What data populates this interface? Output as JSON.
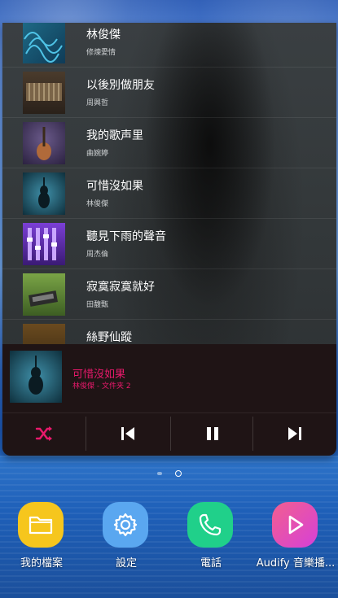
{
  "playlist": [
    {
      "title": "林俊傑",
      "artist": "修煉愛情"
    },
    {
      "title": "以後別做朋友",
      "artist": "周興哲"
    },
    {
      "title": "我的歌声里",
      "artist": "曲婉婷"
    },
    {
      "title": "可惜沒如果",
      "artist": "林俊傑"
    },
    {
      "title": "聽見下雨的聲音",
      "artist": "周杰倫"
    },
    {
      "title": "寂寞寂寞就好",
      "artist": "田馥甄"
    },
    {
      "title": "絲野仙蹤",
      "artist": ""
    }
  ],
  "now_playing": {
    "title": "可惜沒如果",
    "subtitle": "林俊傑 - 文件夹 2"
  },
  "controls": [
    "shuffle-icon",
    "previous-icon",
    "pause-icon",
    "next-icon"
  ],
  "dock": [
    {
      "label": "我的檔案",
      "icon": "folder-icon",
      "color": "#f6c61d"
    },
    {
      "label": "設定",
      "icon": "gear-icon",
      "color": "#5aa7f0"
    },
    {
      "label": "電話",
      "icon": "phone-icon",
      "color": "#20d08a"
    },
    {
      "label": "Audify 音樂播...",
      "icon": "play-icon",
      "color": "#e24fc7"
    }
  ],
  "accent_color": "#e8196b"
}
